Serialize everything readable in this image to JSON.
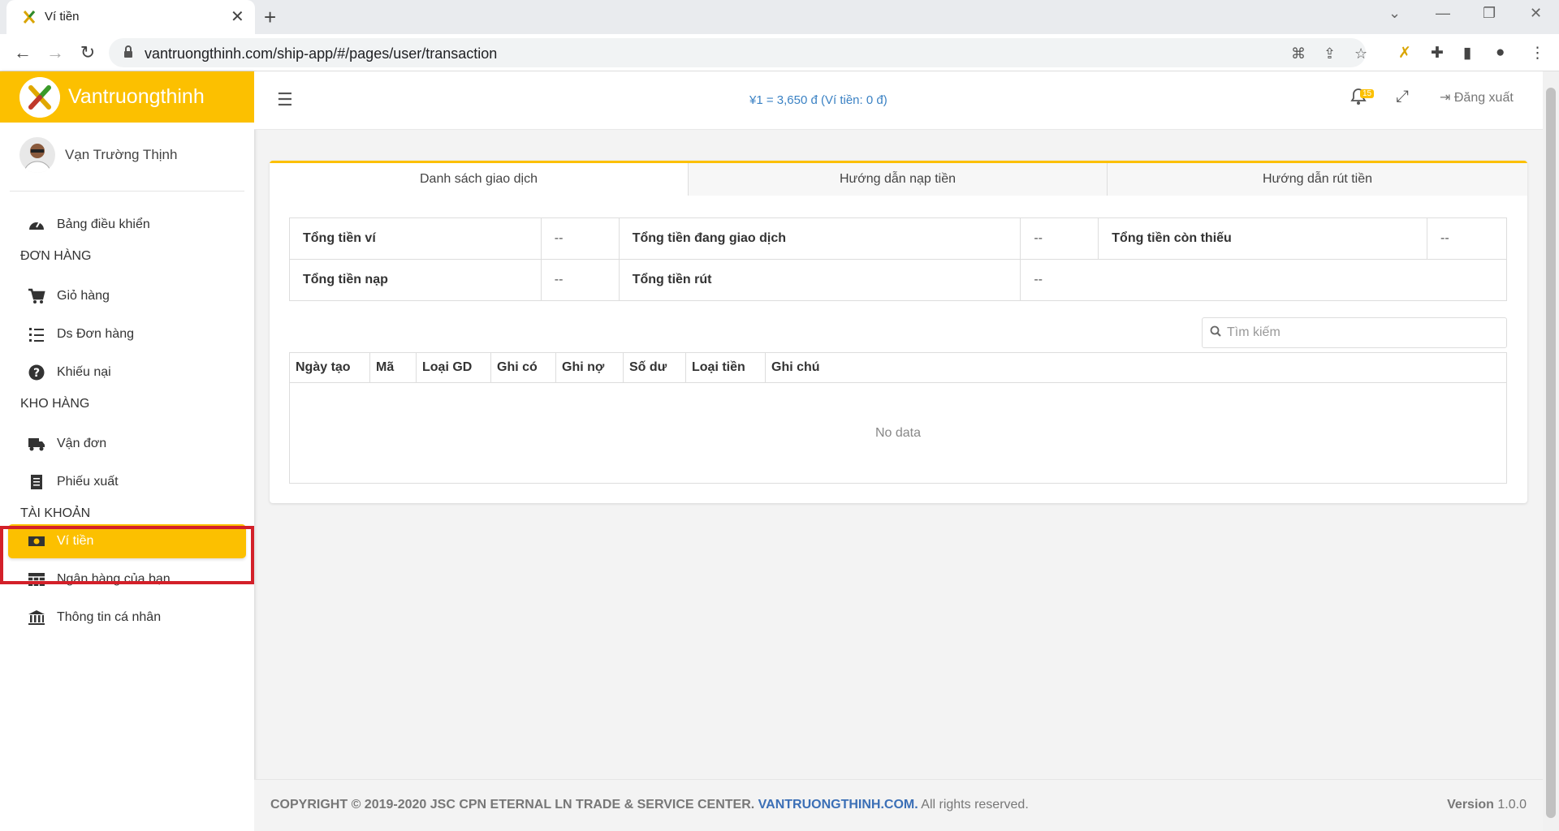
{
  "browser": {
    "tab_title": "Ví tiền",
    "url": "vantruongthinh.com/ship-app/#/pages/user/transaction"
  },
  "sidebar": {
    "brand": "Vantruongthinh",
    "user_name": "Vạn Trường Thịnh",
    "sections": [
      {
        "title": "",
        "items": [
          {
            "label": "Bảng điều khiển",
            "icon": "dashboard-icon"
          }
        ]
      },
      {
        "title": "ĐƠN HÀNG",
        "items": [
          {
            "label": "Giỏ hàng",
            "icon": "cart-icon"
          },
          {
            "label": "Ds Đơn hàng",
            "icon": "list-icon"
          },
          {
            "label": "Khiếu nại",
            "icon": "question-icon"
          }
        ]
      },
      {
        "title": "KHO HÀNG",
        "items": [
          {
            "label": "Vận đơn",
            "icon": "truck-icon"
          },
          {
            "label": "Phiếu xuất",
            "icon": "receipt-icon"
          }
        ]
      },
      {
        "title": "TÀI KHOẢN",
        "items": [
          {
            "label": "Ví tiền",
            "icon": "money-icon",
            "active": true
          },
          {
            "label": "Ngân hàng của bạn",
            "icon": "table-icon"
          },
          {
            "label": "Thông tin cá nhân",
            "icon": "bank-icon"
          }
        ]
      }
    ]
  },
  "topbar": {
    "rate": "¥1 = 3,650 đ (Ví tiền: 0 đ)",
    "notifications": "15",
    "logout": "Đăng xuất"
  },
  "tabs": [
    "Danh sách giao dịch",
    "Hướng dẫn nạp tiền",
    "Hướng dẫn rút tiền"
  ],
  "summary": {
    "row1": [
      {
        "label": "Tổng tiền ví",
        "value": "--"
      },
      {
        "label": "Tổng tiền đang giao dịch",
        "value": "--"
      },
      {
        "label": "Tổng tiền còn thiếu",
        "value": "--"
      }
    ],
    "row2": [
      {
        "label": "Tổng tiền nạp",
        "value": "--"
      },
      {
        "label": "Tổng tiền rút",
        "value": "--"
      }
    ]
  },
  "search_placeholder": "Tìm kiếm",
  "table": {
    "columns": [
      "Ngày tạo",
      "Mã",
      "Loại GD",
      "Ghi có",
      "Ghi nợ",
      "Số dư",
      "Loại tiền",
      "Ghi chú"
    ],
    "empty": "No data"
  },
  "footer": {
    "copyright": "COPYRIGHT © 2019-2020 JSC CPN ETERNAL LN TRADE & SERVICE CENTER.",
    "company_link": "VANTRUONGTHINH.COM.",
    "rights": "All rights reserved.",
    "version_label": "Version",
    "version": "1.0.0"
  },
  "colors": {
    "accent": "#fcc000",
    "link": "#3b82c4",
    "highlight": "#d32029"
  }
}
